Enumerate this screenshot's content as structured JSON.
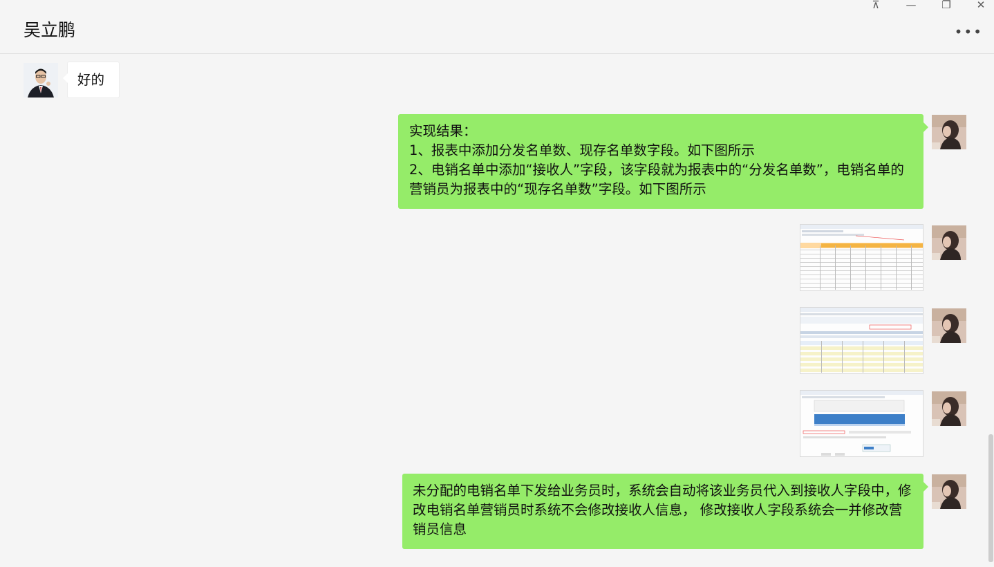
{
  "window": {
    "title": "吴立鹏"
  },
  "controls": {
    "pin": "⊼",
    "minimize": "—",
    "restore": "❐",
    "close": "✕",
    "more": "•••"
  },
  "messages": [
    {
      "from": "contact",
      "lines": [
        "好的"
      ]
    },
    {
      "from": "me",
      "lines": [
        "实现结果：",
        "1、报表中添加分发名单数、现存名单数字段。如下图所示",
        "2、电销名单中添加“接收人”字段，该字段就为报表中的“分发名单数”，电销名单的营销员为报表中的“现存名单数”字段。如下图所示"
      ]
    },
    {
      "from": "me",
      "type": "image",
      "description_name": "report-screenshot"
    },
    {
      "from": "me",
      "type": "image",
      "description_name": "list-screenshot"
    },
    {
      "from": "me",
      "type": "image",
      "description_name": "dialog-screenshot"
    },
    {
      "from": "me",
      "lines": [
        "未分配的电销名单下发给业务员时，系统会自动将该业务员代入到接收人字段中，修改电销名单营销员时系统不会修改接收人信息， 修改接收人字段系统会一并修改营销员信息"
      ]
    }
  ],
  "colors": {
    "my_bubble": "#95ec69",
    "contact_bubble": "#ffffff",
    "background": "#f5f5f5"
  }
}
